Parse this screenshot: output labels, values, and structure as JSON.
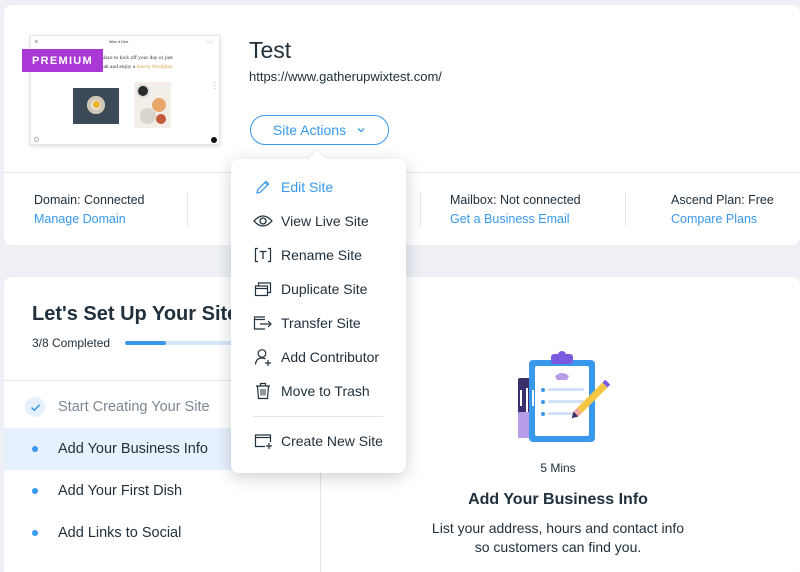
{
  "site": {
    "badge": "PREMIUM",
    "name": "Test",
    "url": "https://www.gatherupwixtest.com/",
    "actions_label": "Site Actions",
    "thumbnail": {
      "brand": "Wine & Dine",
      "line1": "place to kick off your day or just",
      "line2_prefix": "eak and enjoy a ",
      "line2_highlight": "hearty breakfast"
    }
  },
  "stats": [
    {
      "label": "Domain: Connected",
      "link": "Manage Domain"
    },
    {
      "label": "Mailbox: Not connected",
      "link": "Get a Business Email"
    },
    {
      "label": "Ascend Plan: Free",
      "link": "Compare Plans"
    }
  ],
  "menu": {
    "items": [
      {
        "label": "Edit Site",
        "icon": "pencil-icon"
      },
      {
        "label": "View Live Site",
        "icon": "eye-icon"
      },
      {
        "label": "Rename Site",
        "icon": "rename-text-icon"
      },
      {
        "label": "Duplicate Site",
        "icon": "duplicate-icon"
      },
      {
        "label": "Transfer Site",
        "icon": "transfer-icon"
      },
      {
        "label": "Add Contributor",
        "icon": "add-user-icon"
      },
      {
        "label": "Move to Trash",
        "icon": "trash-icon"
      },
      {
        "label": "Create New Site",
        "icon": "new-site-icon"
      }
    ]
  },
  "setup": {
    "title": "Let's Set Up Your Site",
    "progress_text": "3/8 Completed",
    "progress": 0.375,
    "steps": [
      {
        "label": "Start Creating Your Site",
        "status": "done"
      },
      {
        "label": "Add Your Business Info",
        "status": "active"
      },
      {
        "label": "Add Your First Dish",
        "status": "todo"
      },
      {
        "label": "Add Links to Social",
        "status": "todo"
      }
    ],
    "detail": {
      "duration": "5 Mins",
      "title": "Add Your Business Info",
      "description": "List your address, hours and contact info so customers can find you."
    }
  },
  "colors": {
    "accent": "#3899ec",
    "premium": "#aa38d6",
    "active_row": "#e7f0fd"
  }
}
